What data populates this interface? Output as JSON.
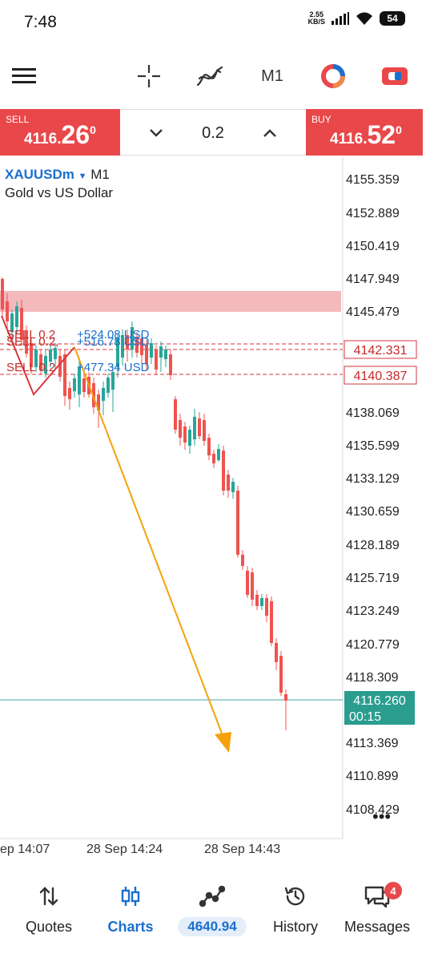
{
  "status": {
    "time": "7:48",
    "net_speed_value": "2.55",
    "net_speed_unit": "KB/S",
    "battery": "54"
  },
  "toolbar": {
    "timeframe": "M1",
    "icons": [
      "menu-icon",
      "crosshair-icon",
      "indicators-icon",
      "timeframe",
      "chart-type-icon",
      "trade-toggle-icon"
    ]
  },
  "trade": {
    "sell_label": "SELL",
    "sell_price_prefix": "4116.",
    "sell_price_big": "26",
    "sell_price_sup": "0",
    "buy_label": "BUY",
    "buy_price_prefix": "4116.",
    "buy_price_big": "52",
    "buy_price_sup": "0",
    "lot": "0.2"
  },
  "chart": {
    "symbol": "XAUUSDm",
    "timeframe": "M1",
    "description": "Gold vs US Dollar",
    "price_ticks": [
      "4155.359",
      "4152.889",
      "4150.419",
      "4147.949",
      "4145.479",
      "4142.331",
      "4140.387",
      "4138.069",
      "4135.599",
      "4133.129",
      "4130.659",
      "4128.189",
      "4125.719",
      "4123.249",
      "4120.779",
      "4118.309",
      "4113.369",
      "4110.899",
      "4108.429"
    ],
    "time_ticks": [
      "ep 14:07",
      "28 Sep 14:24",
      "28 Sep 14:43"
    ],
    "current_price": "4116.260",
    "countdown": "00:15",
    "order_lines": [
      {
        "label": "SELL 0.2",
        "profit": "+524.08 USD"
      },
      {
        "label": "SELL 0.2,",
        "profit": "+516.78 USD"
      },
      {
        "label": "SELL 0.2",
        "profit": "+477.34 USD"
      }
    ],
    "more_label": "•••",
    "colors": {
      "bull": "#26a69a",
      "bear": "#ef5350",
      "zone": "#f2b8bb",
      "arrow": "#f5a10a",
      "bid_line": "#4aa3a3"
    }
  },
  "nav": {
    "items": [
      {
        "label": "Quotes"
      },
      {
        "label": "Charts"
      },
      {
        "label": "4640.94"
      },
      {
        "label": "History"
      },
      {
        "label": "Messages",
        "badge": "4"
      }
    ]
  }
}
